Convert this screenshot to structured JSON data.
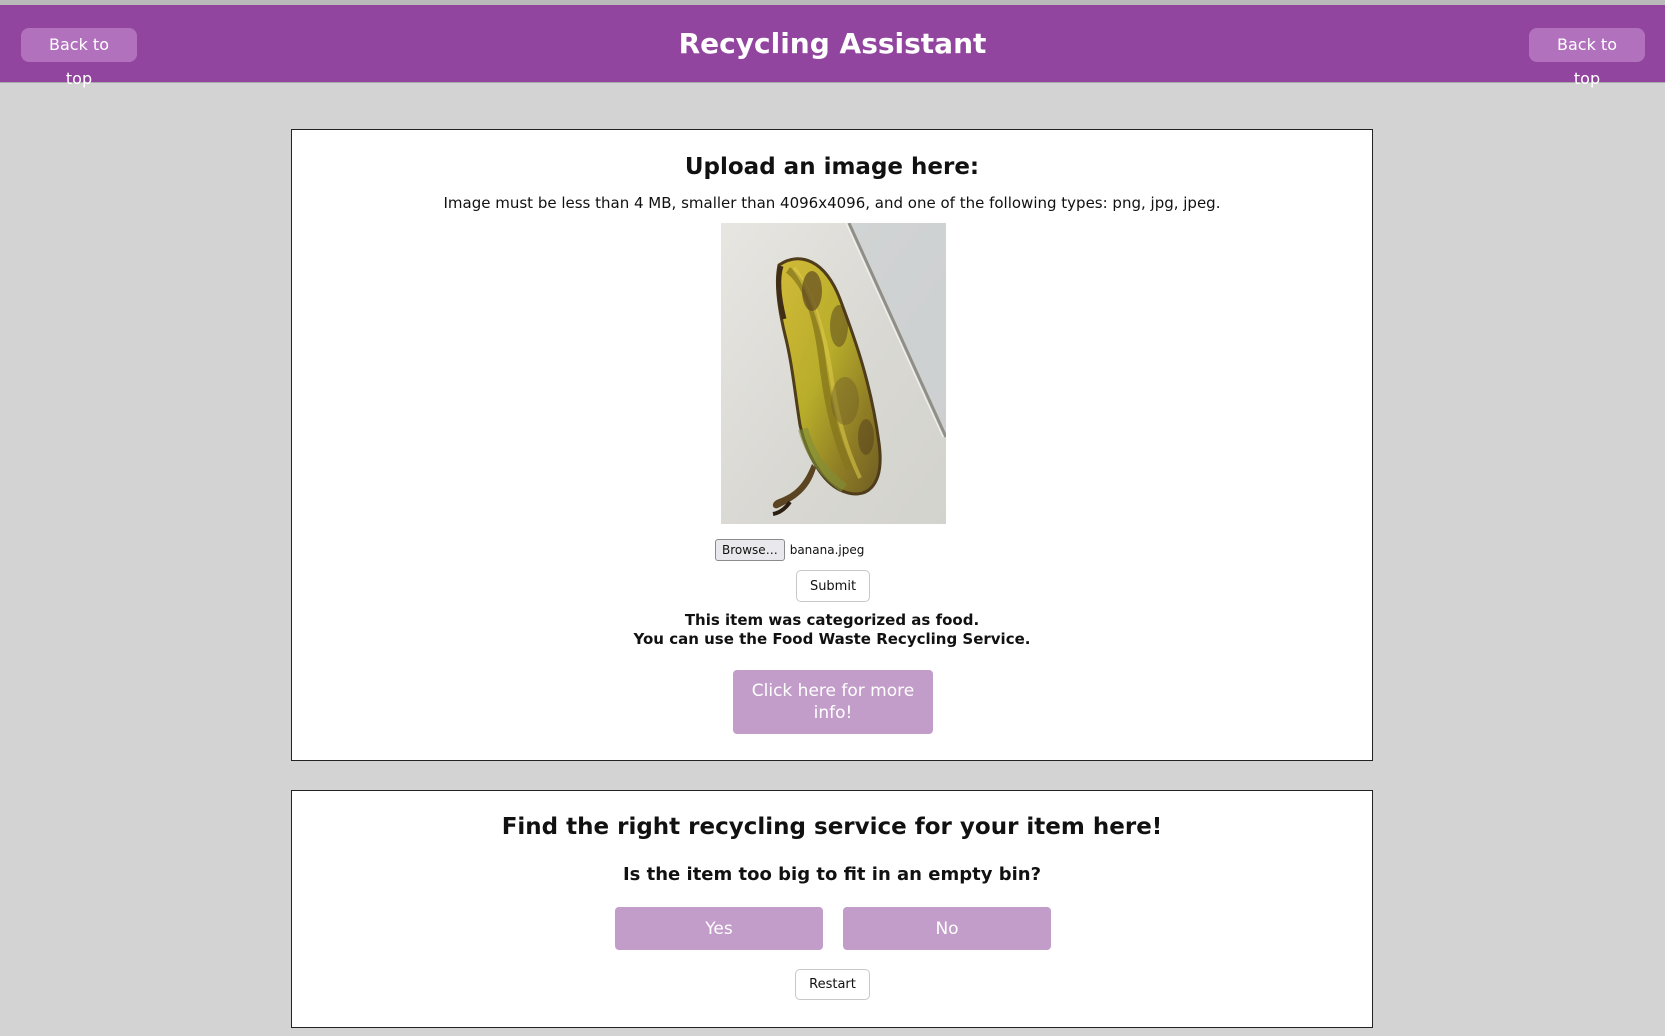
{
  "header": {
    "title": "Recycling Assistant",
    "back_to_top_left": "Back to top",
    "back_to_top_right": "Back to top"
  },
  "upload": {
    "title": "Upload an image here:",
    "instructions": "Image must be less than 4 MB, smaller than 4096x4096, and one of the following types: png, jpg, jpeg.",
    "browse_label": "Browse…",
    "file_name": "banana.jpeg",
    "submit_label": "Submit",
    "result_line_1": "This item was categorized as food.",
    "result_line_2": "You can use the Food Waste Recycling Service.",
    "more_info_label": "Click here for more info!"
  },
  "finder": {
    "title": "Find the right recycling service for your item here!",
    "question": "Is the item too big to fit in an empty bin?",
    "yes_label": "Yes",
    "no_label": "No",
    "restart_label": "Restart"
  },
  "colors": {
    "header": "#92459f",
    "header_button": "#b171bd",
    "accent_button": "#c39dca",
    "background": "#d3d3d3"
  }
}
